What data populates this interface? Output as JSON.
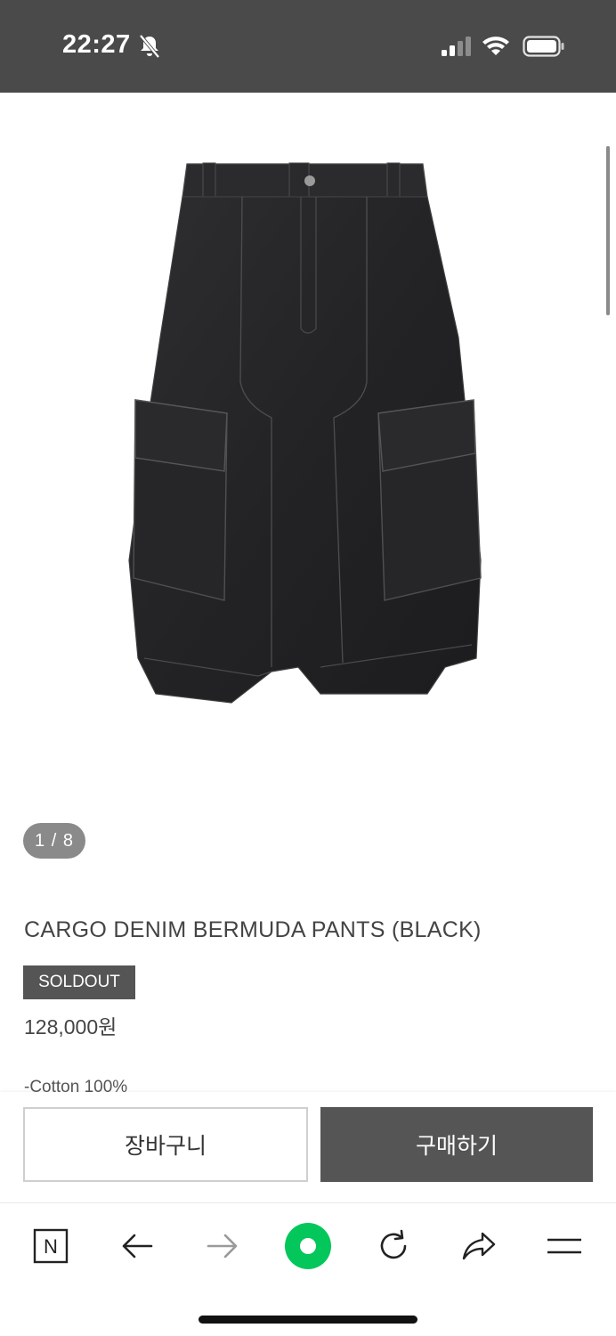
{
  "status_bar": {
    "time": "22:27"
  },
  "gallery": {
    "counter": "1 / 8"
  },
  "product": {
    "title": "CARGO DENIM BERMUDA PANTS (BLACK)",
    "badge": "SOLDOUT",
    "price": "128,000원",
    "description_preview": "-Cotton 100%"
  },
  "actions": {
    "cart_label": "장바구니",
    "buy_label": "구매하기"
  },
  "toolbar": {
    "home_label": "N",
    "icons": [
      "naver-home-icon",
      "back-arrow-icon",
      "forward-arrow-icon",
      "green-dot-icon",
      "reload-icon",
      "share-icon",
      "menu-icon"
    ]
  },
  "colors": {
    "status_bar_bg": "#4a4a4a",
    "badge_bg": "#555555",
    "buy_button_bg": "#555555",
    "green_accent": "#03c75a"
  }
}
